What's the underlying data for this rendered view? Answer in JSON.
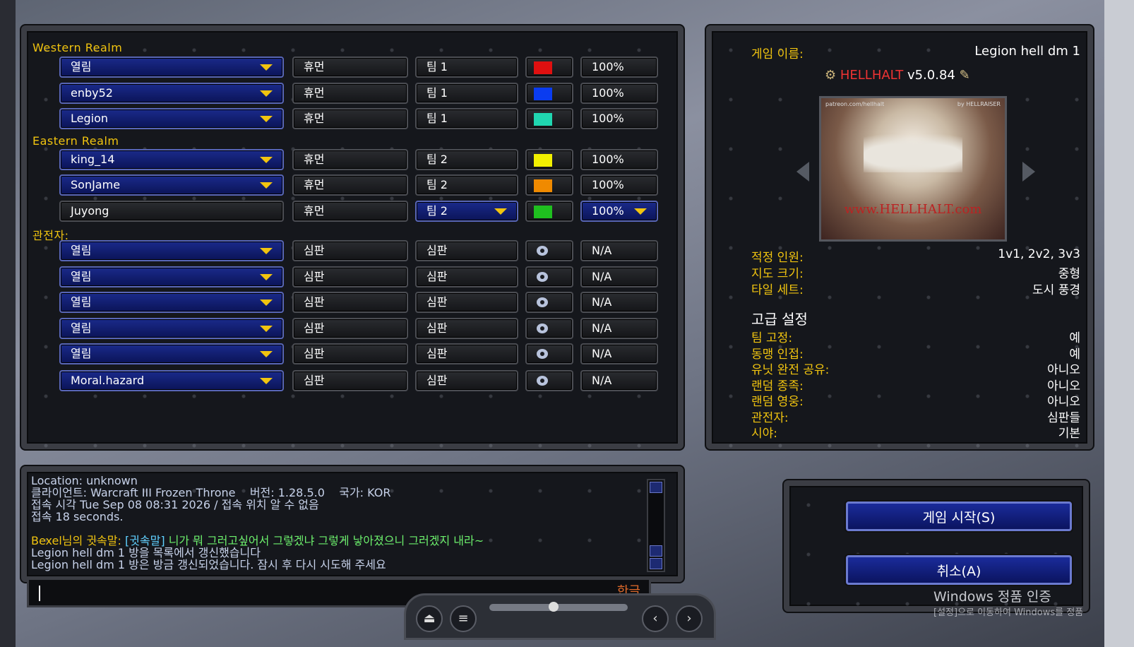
{
  "left_panel": {
    "western_label": "Western Realm",
    "eastern_label": "Eastern Realm",
    "observers_label": "관전자:",
    "rows": [
      {
        "name": "열림",
        "race": "휴먼",
        "team": "팀 1",
        "color": "#e01010",
        "handicap": "100%"
      },
      {
        "name": "enby52",
        "race": "휴먼",
        "team": "팀 1",
        "color": "#0a3cf0",
        "handicap": "100%"
      },
      {
        "name": "Legion",
        "race": "휴먼",
        "team": "팀 1",
        "color": "#20d6b0",
        "handicap": "100%"
      },
      {
        "name": "king_14",
        "race": "휴먼",
        "team": "팀 2",
        "color": "#f2f000",
        "handicap": "100%"
      },
      {
        "name": "SonJame",
        "race": "휴먼",
        "team": "팀 2",
        "color": "#f08a00",
        "handicap": "100%"
      },
      {
        "name": "Juyong",
        "race": "휴먼",
        "team": "팀 2",
        "color": "#1fbf1f",
        "handicap": "100%"
      },
      {
        "name": "열림",
        "race": "심판",
        "team": "심판",
        "color": "eye",
        "handicap": "N/A"
      },
      {
        "name": "열림",
        "race": "심판",
        "team": "심판",
        "color": "eye",
        "handicap": "N/A"
      },
      {
        "name": "열림",
        "race": "심판",
        "team": "심판",
        "color": "eye",
        "handicap": "N/A"
      },
      {
        "name": "열림",
        "race": "심판",
        "team": "심판",
        "color": "eye",
        "handicap": "N/A"
      },
      {
        "name": "열림",
        "race": "심판",
        "team": "심판",
        "color": "eye",
        "handicap": "N/A"
      },
      {
        "name": "Moral.hazard",
        "race": "심판",
        "team": "심판",
        "color": "eye",
        "handicap": "N/A"
      }
    ]
  },
  "info_panel": {
    "game_name_label": "게임 이름:",
    "game_name": "Legion hell dm 1",
    "version_red": "HELLHALT",
    "version_rest": " v5.0.84",
    "preview_url_text": "patreon.com/hellhalt",
    "preview_by_text": "by HELLRAISER",
    "preview_logo_text": "www.HELLHALT.com",
    "players_label": "적정 인원:",
    "players_value": "1v1, 2v2, 3v3",
    "map_size_label": "지도 크기:",
    "map_size_value": "중형",
    "tileset_label": "타일 세트:",
    "tileset_value": "도시 풍경",
    "advanced_title": "고급 설정",
    "settings": [
      {
        "label": "팀 고정:",
        "value": "예"
      },
      {
        "label": "동맹 인접:",
        "value": "예"
      },
      {
        "label": "유닛 완전 공유:",
        "value": "아니오"
      },
      {
        "label": "랜덤 종족:",
        "value": "아니오"
      },
      {
        "label": "랜덤 영웅:",
        "value": "아니오"
      },
      {
        "label": "관전자:",
        "value": "심판들"
      },
      {
        "label": "시야:",
        "value": "기본"
      }
    ]
  },
  "chat": {
    "line1": "Location: unknown",
    "line2": "클라이언트: Warcraft III Frozen Throne    버전: 1.28.5.0    국가: KOR",
    "line3": "접속 시각 Tue Sep 08 08:31 2026 / 접속 위치 알 수 없음",
    "line4": "접속 18 seconds.",
    "whisper_from": "Bexel님의 귓속말: ",
    "whisper_tag": "[귓속말] ",
    "whisper_text": "니가 뭐 그러고싶어서 그렇겠냐 그렇게 낳아졌으니 그러겠지 내라~",
    "line6": "Legion hell dm 1 방을 목록에서 갱신했습니다",
    "line7": "Legion hell dm 1 방은 방금 갱신되었습니다. 잠시 후 다시 시도해 주세요",
    "input_lang": "한글"
  },
  "buttons": {
    "start": "게임 시작(S)",
    "cancel": "취소(A)"
  },
  "watermark": {
    "line1": "Windows 정품 인증",
    "line2": "[설정]으로 이동하여 Windows를 정품"
  }
}
